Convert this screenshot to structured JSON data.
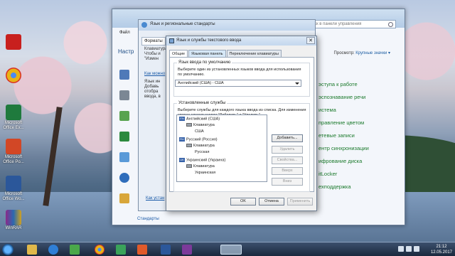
{
  "desktop": {
    "icons": [
      {
        "label": "Acrobat",
        "color": "#c8201e"
      },
      {
        "label": "Chrome",
        "color": "#e8b217"
      },
      {
        "label": "Microsoft Office Ex...",
        "color": "#1f7a3d"
      },
      {
        "label": "Microsoft Office Po...",
        "color": "#d24726"
      },
      {
        "label": "Microsoft Office Wo...",
        "color": "#2b579a"
      },
      {
        "label": "WinRAR",
        "color": "#8a2a8a"
      }
    ]
  },
  "control_panel": {
    "menu_label": "Файл",
    "nav_label": "Настр",
    "search_placeholder": "Поиск в панели управления",
    "view_label": "Просмотр:",
    "view_value": "Крупные значки ▾",
    "links": [
      "эступа к работе",
      "эспознавание речи",
      "истема",
      "правление цветом",
      "етевые записи",
      "ентр синхронизации",
      "ифрование диска",
      "itLocker",
      "ехподдержка"
    ],
    "bottom_link": "Стандарты"
  },
  "regional": {
    "title": "Язык и региональные стандарты",
    "tab": "Форматы",
    "lines": [
      "Клавиатура",
      "Чтобы и",
      "\"Измен",
      "",
      "Язык ин",
      "Добавь",
      "отобра",
      "ввода, в"
    ],
    "link": "Как можно",
    "bottom_link": "Как устан"
  },
  "dialog": {
    "title": "Язык и службы текстового ввода",
    "close": "✕",
    "tabs": [
      "Общие",
      "Языковая панель",
      "Переключение клавиатуры"
    ],
    "default_group": "Язык ввода по умолчанию",
    "default_desc": "Выберите один из установленных языков ввода для использования по умолчанию.",
    "default_value": "Английский (США) - США",
    "services_group": "Установленные службы",
    "services_desc": "Выберите службы для каждого языка ввода из списка. Для изменения списка служат кнопки \"Добавить\" и \"Удалить\".",
    "tree": [
      {
        "flag": "EN",
        "text": "Английский (США)",
        "level": 0
      },
      {
        "flag": "",
        "text": "Клавиатура",
        "level": 1
      },
      {
        "flag": "",
        "text": "США",
        "level": 2
      },
      {
        "flag": "RU",
        "text": "Русский (Россия)",
        "level": 0
      },
      {
        "flag": "",
        "text": "Клавиатура",
        "level": 1
      },
      {
        "flag": "",
        "text": "Русская",
        "level": 2
      },
      {
        "flag": "UK",
        "text": "Украинский (Украина)",
        "level": 0
      },
      {
        "flag": "",
        "text": "Клавиатура",
        "level": 1
      },
      {
        "flag": "",
        "text": "Украинская",
        "level": 2
      }
    ],
    "buttons": {
      "add": "Добавить...",
      "remove": "Удалить",
      "properties": "Свойства...",
      "up": "Вверх",
      "down": "Вниз",
      "ok": "OK",
      "cancel": "Отмена",
      "apply": "Применить"
    }
  },
  "taskbar": {
    "apps": [
      {
        "name": "explorer",
        "color": "#e0b84a"
      },
      {
        "name": "media-player",
        "color": "#2f7fd6"
      },
      {
        "name": "utorrent",
        "color": "#4aa84a"
      },
      {
        "name": "chrome",
        "color": "#e8b217"
      },
      {
        "name": "camtasia",
        "color": "#3aa35a"
      },
      {
        "name": "recorder",
        "color": "#e05a2a"
      },
      {
        "name": "word",
        "color": "#2b579a"
      },
      {
        "name": "onenote",
        "color": "#7c3a9a"
      },
      {
        "name": "control-panel",
        "color": "#5d8fc7"
      }
    ],
    "time": "21:12",
    "date": "12.05.2017"
  }
}
